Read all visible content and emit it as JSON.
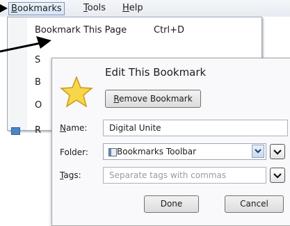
{
  "menubar": {
    "bookmarks": {
      "mnemonic": "B",
      "rest": "ookmarks"
    },
    "tools": {
      "mnemonic": "T",
      "rest": "ools"
    },
    "help": {
      "mnemonic": "H",
      "rest": "elp"
    }
  },
  "dropdown": {
    "bookmark_this_page": "Bookmark This Page",
    "shortcut": "Ctrl+D",
    "fragment_2": "S",
    "fragment_3": "B",
    "fragment_4": "O",
    "fragment_5": "R"
  },
  "dialog": {
    "title": "Edit This Bookmark",
    "remove_button": {
      "mnemonic": "R",
      "rest": "emove Bookmark"
    },
    "name_label": {
      "mnemonic": "N",
      "rest": "ame:"
    },
    "name_value": "Digital Unite",
    "folder_label": "Folder:",
    "folder_value": "Bookmarks Toolbar",
    "tags_label": {
      "mnemonic": "T",
      "rest": "ags:"
    },
    "tags_placeholder": "Separate tags with commas",
    "done_button": "Done",
    "cancel_button": "Cancel"
  },
  "icons": {
    "star": "star-icon",
    "folder": "bookmarks-toolbar-icon",
    "dropdown_arrow": "chevron-down-icon",
    "pointer_arrow": "arrow-annotation"
  },
  "colors": {
    "star_fill": "#f7d64a",
    "star_edge": "#c99a18",
    "menu_highlight": "#d7e5f5",
    "arrow": "#000000"
  }
}
